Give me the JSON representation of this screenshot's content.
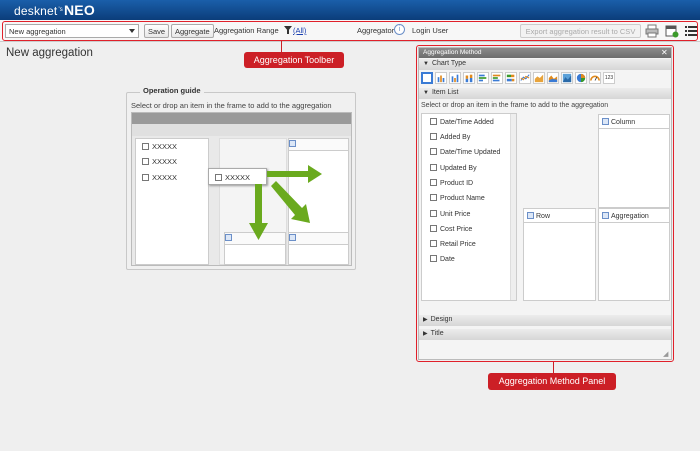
{
  "header": {
    "logo_main": "desknet",
    "logo_sup": "'s",
    "logo_neo": "NEO"
  },
  "toolbar": {
    "select_value": "New aggregation",
    "save_label": "Save",
    "aggregate_label": "Aggregate",
    "range_label": "Aggregation Range",
    "range_link": "(All)",
    "aggregator_label": "Aggregator",
    "info_glyph": "i",
    "login_user_label": "Login User",
    "export_label": "Export aggregation result to CSV"
  },
  "page": {
    "title": "New aggregation"
  },
  "callouts": {
    "toolbar": "Aggregation Toolber",
    "panel": "Aggregation Method Panel"
  },
  "guide": {
    "legend": "Operation guide",
    "instruction": "Select or drop an item in the frame to add to the aggregation",
    "items": [
      "XXXXX",
      "XXXXX",
      "XXXXX"
    ],
    "drag_item": "XXXXX"
  },
  "panel": {
    "title": "Aggregation Method",
    "close_glyph": "✕",
    "chart_type_label": "Chart Type",
    "item_list_label": "Item List",
    "instruction": "Select or drop an item in the frame to add to the aggregation",
    "items": [
      "Date/Time Added",
      "Added By",
      "Date/Time Updated",
      "Updated By",
      "Product ID",
      "Product Name",
      "Unit Price",
      "Cost Price",
      "Retail Price",
      "Date"
    ],
    "column_label": "Column",
    "row_label": "Row",
    "aggregation_label": "Aggregation",
    "design_label": "Design",
    "title_label": "Title",
    "chart_icons": [
      "table-icon",
      "bar-chart-icon",
      "bar-chart-icon",
      "stacked-bar-icon",
      "horizontal-bar-icon",
      "horizontal-bar-icon",
      "stacked-hbar-icon",
      "line-chart-icon",
      "area-chart-icon",
      "area-chart-icon",
      "area-chart-icon",
      "pie-chart-icon",
      "gauge-icon",
      "number-icon"
    ],
    "number_icon_text": "123"
  },
  "colors": {
    "header": "#1a5faa",
    "callout": "#cc1f26",
    "arrow": "#6aaa1e"
  }
}
